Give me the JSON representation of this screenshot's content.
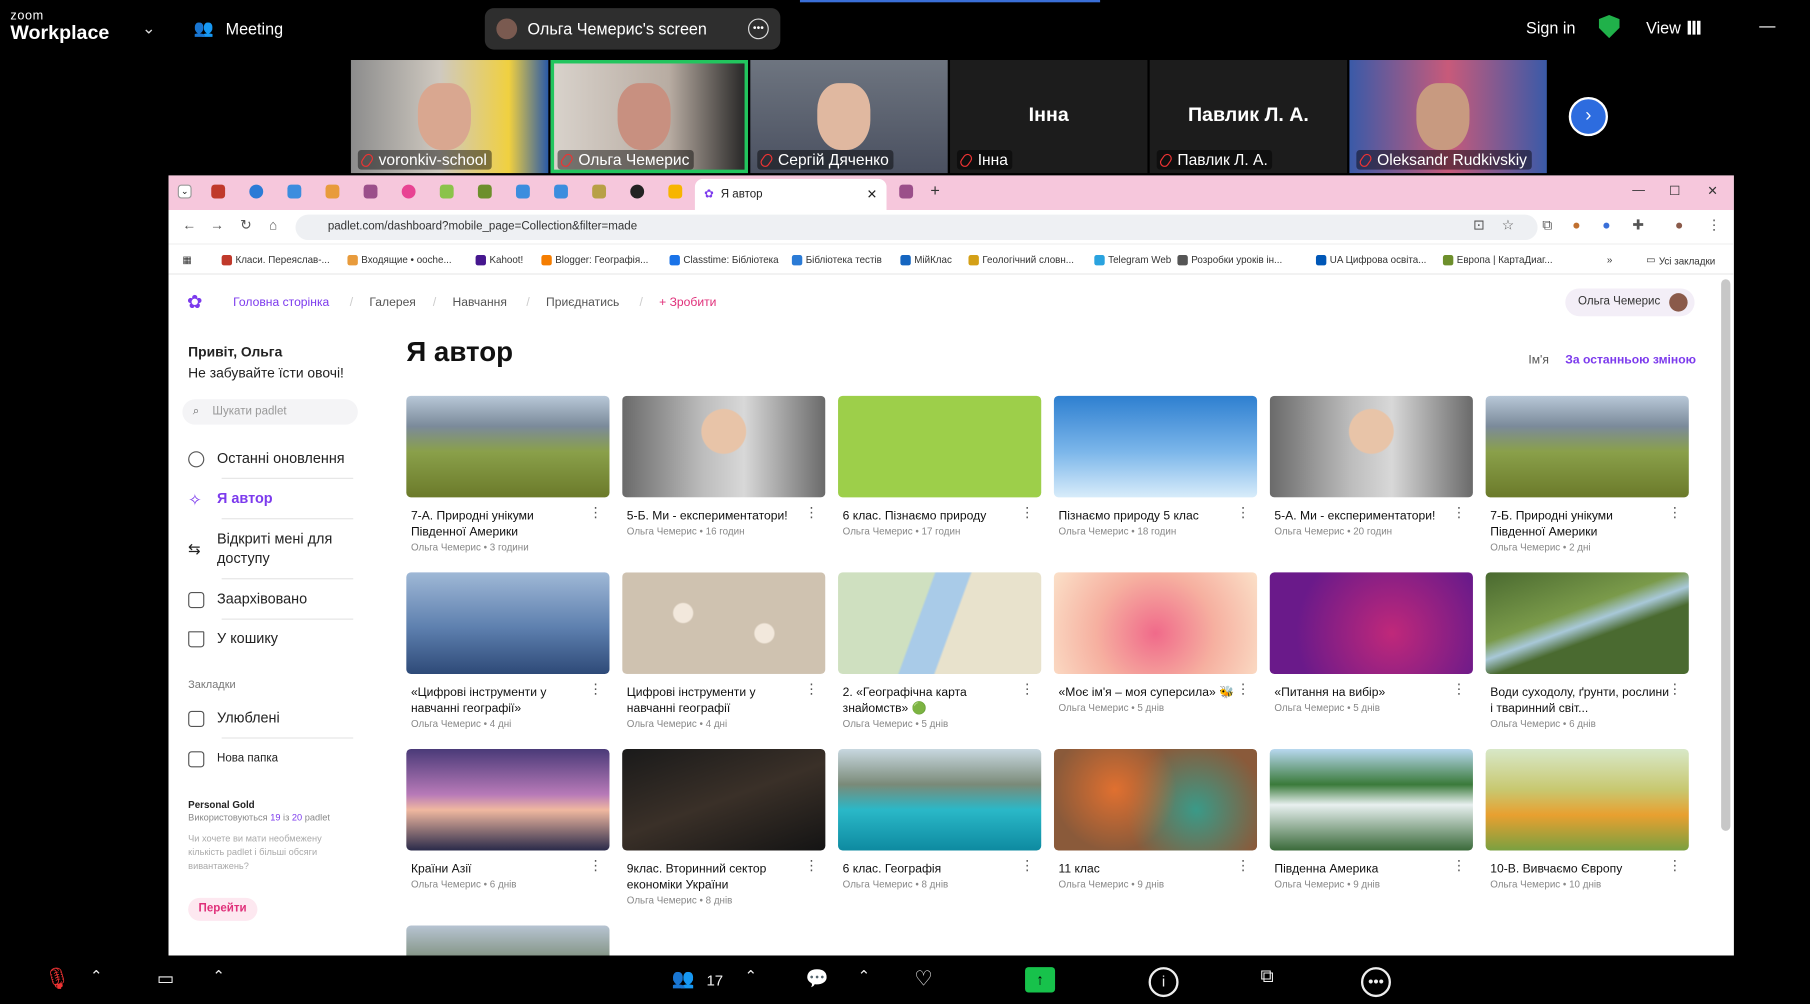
{
  "zoom": {
    "brand_small": "zoom",
    "brand_big": "Workplace",
    "meeting_label": "Meeting",
    "share_label": "Ольга Чемерис's screen",
    "sign_in": "Sign in",
    "view": "View",
    "participants": [
      {
        "name": "voronkiv-school",
        "video": true
      },
      {
        "name": "Ольга Чемерис",
        "video": true,
        "active": true
      },
      {
        "name": "Сергій Дяченко",
        "video": true
      },
      {
        "name": "Інна",
        "big": "Інна",
        "video": false
      },
      {
        "name": "Павлик Л. А.",
        "big": "Павлик Л. А.",
        "video": false
      },
      {
        "name": "Oleksandr Rudkivskiy",
        "video": true
      }
    ],
    "participant_count": "17"
  },
  "browser": {
    "tab_title": "Я автор",
    "new_tab": "+",
    "url": "padlet.com/dashboard?mobile_page=Collection&filter=made",
    "bookmarks": [
      "Класи. Переяслав-...",
      "Входящие • ooche...",
      "Kahoot!",
      "Blogger: Географія...",
      "Classtime: Бібліотека",
      "Бібліотека тестів",
      "МійКлас",
      "Геологічний словн...",
      "Telegram Web",
      "Розробки уроків ін...",
      "UA Цифрова освіта...",
      "Европа | КартаДиаг..."
    ],
    "bookmarks_more": "»",
    "all_bookmarks": "Усі закладки"
  },
  "padlet": {
    "nav": {
      "home": "Головна сторінка",
      "gallery": "Галерея",
      "learning": "Навчання",
      "join": "Приєднатись",
      "make": "+ Зробити"
    },
    "user": "Ольга Чемерис",
    "greeting": "Привіт, Ольга",
    "tagline": "Не забувайте їсти овочі!",
    "search_placeholder": "Шукати padlet",
    "sidebar": [
      "Останні оновлення",
      "Я автор",
      "Відкриті мені для доступу",
      "Заархівовано",
      "У кошику"
    ],
    "bookmarks_heading": "Закладки",
    "favorites": "Улюблені",
    "new_folder": "Нова папка",
    "plan": "Personal Gold",
    "usage_prefix": "Використовуються ",
    "usage_used": "19",
    "usage_mid": " із ",
    "usage_total": "20",
    "usage_suffix": " padlet",
    "upsell": "Чи хочете ви мати необмежену кількість padlet і більші обсяги вивантажень?",
    "go": "Перейти",
    "title": "Я автор",
    "sort_name": "Ім'я",
    "sort_recent": "За останньою зміною",
    "cards": [
      {
        "title": "7-А. Природні унікуми Південної Америки",
        "author": "Ольга Чемерис • 3 години",
        "img": "mountain"
      },
      {
        "title": "5-Б. Ми - експериментатори!",
        "author": "Ольга Чемерис • 16 годин",
        "img": "lab"
      },
      {
        "title": "6 клас. Пізнаємо природу",
        "author": "Ольга Чемерис • 17 годин",
        "img": "green"
      },
      {
        "title": "Пізнаємо природу 5 клас",
        "author": "Ольга Чемерис • 18 годин",
        "img": "sky"
      },
      {
        "title": "5-А. Ми - експериментатори!",
        "author": "Ольга Чемерис • 20 годин",
        "img": "lab"
      },
      {
        "title": "7-Б. Природні унікуми Південної Америки",
        "author": "Ольга Чемерис • 2 дні",
        "img": "mountain"
      },
      {
        "title": "«Цифрові інструменти у навчанні географії»",
        "author": "Ольга Чемерис • 4 дні",
        "img": "fog"
      },
      {
        "title": "Цифрові інструменти у навчанні географії",
        "author": "Ольга Чемерис • 4 дні",
        "img": "floral"
      },
      {
        "title": "2. «Географічна карта знайомств» 🟢",
        "author": "Ольга Чемерис • 5 днів",
        "img": "map"
      },
      {
        "title": "«Моє ім'я – моя суперсила» 🐝",
        "author": "Ольга Чемерис • 5 днів",
        "img": "pink"
      },
      {
        "title": "«Питання на вибір»",
        "author": "Ольга Чемерис • 5 днів",
        "img": "purple"
      },
      {
        "title": "Води суходолу, ґрунти, рослини і тваринний світ...",
        "author": "Ольга Чемерис • 6 днів",
        "img": "river"
      },
      {
        "title": "Країни Азії",
        "author": "Ольга Чемерис • 6 днів",
        "img": "temple"
      },
      {
        "title": "9клас. Вторинний сектор економіки України",
        "author": "Ольга Чемерис • 8 днів",
        "img": "city"
      },
      {
        "title": "6 клас. Географія",
        "author": "Ольга Чемерис • 8 днів",
        "img": "lake"
      },
      {
        "title": "11 клас",
        "author": "Ольга Чемерис • 9 днів",
        "img": "paint"
      },
      {
        "title": "Південна Америка",
        "author": "Ольга Чемерис • 9 днів",
        "img": "falls"
      },
      {
        "title": "10-В. Вивчаємо Європу",
        "author": "Ольга Чемерис • 10 днів",
        "img": "meadow"
      }
    ]
  },
  "colors": {
    "accent": "#7c3aed",
    "tabbar": "#f6c7dc",
    "share_green": "#17c24b"
  }
}
